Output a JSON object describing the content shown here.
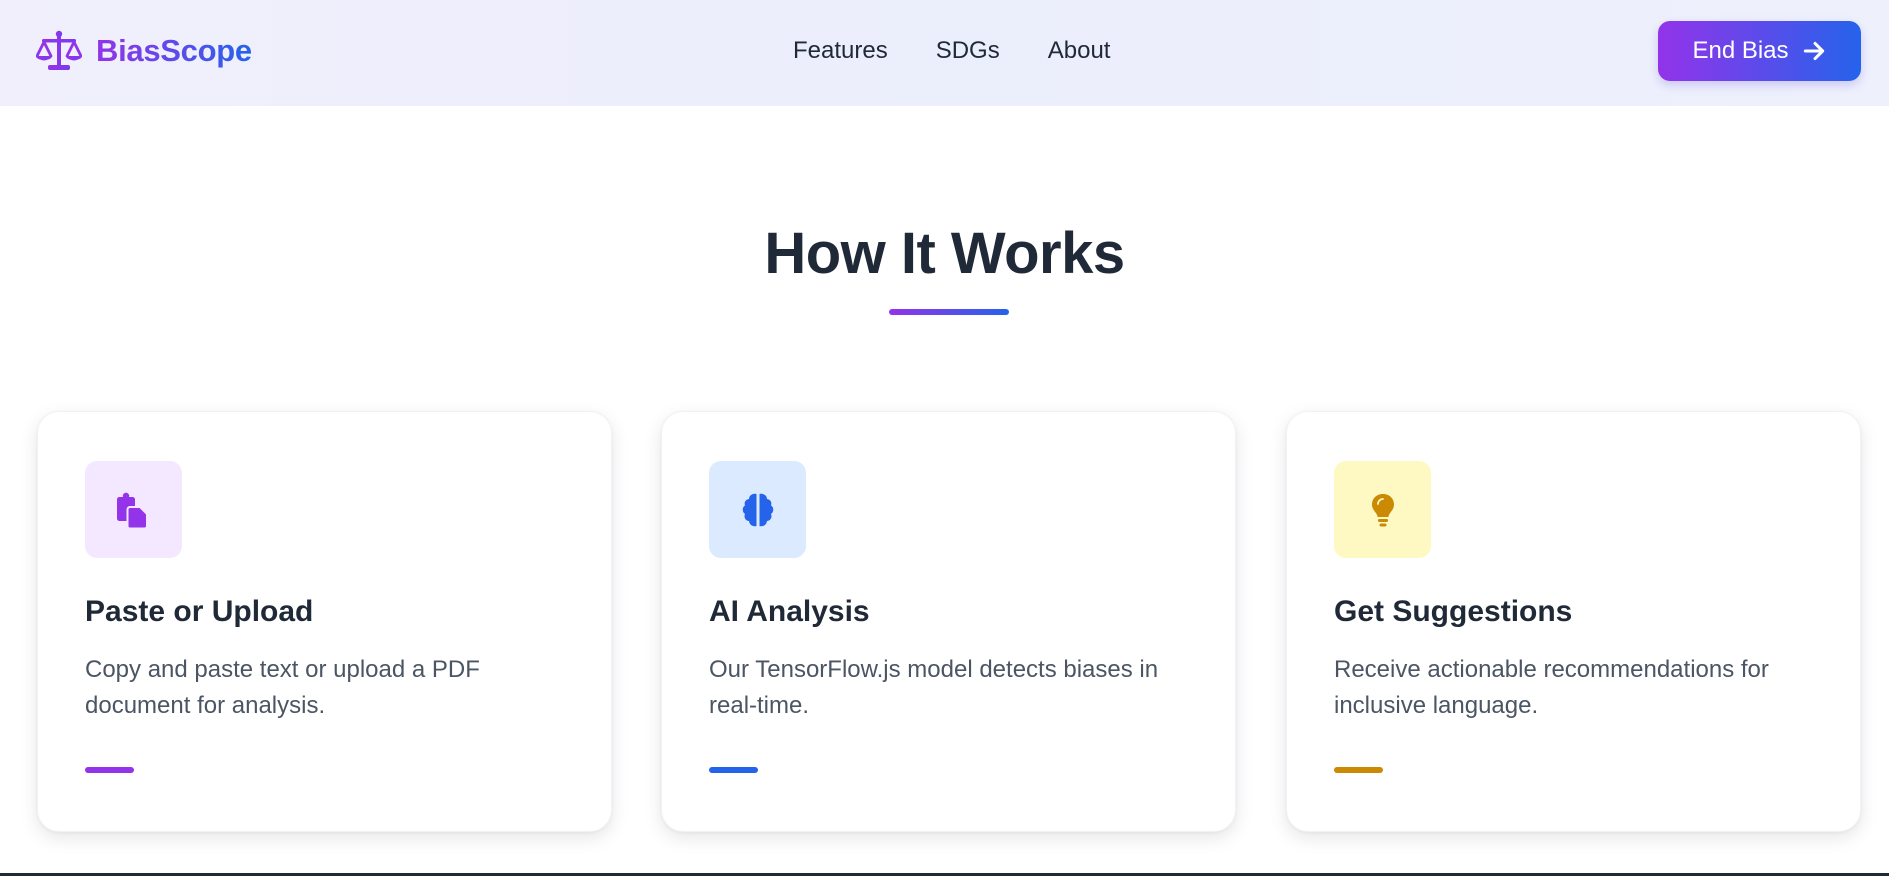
{
  "brand": {
    "name": "BiasScope",
    "icon": "scale-balance-icon"
  },
  "nav": {
    "links": [
      "Features",
      "SDGs",
      "About"
    ]
  },
  "cta": {
    "label": "End Bias",
    "icon": "arrow-right-icon"
  },
  "section": {
    "title": "How It Works"
  },
  "cards": [
    {
      "title": "Paste or Upload",
      "description": "Copy and paste text or upload a PDF document for analysis.",
      "icon": "clipboard-copy-icon",
      "accent_color": "#9333ea",
      "icon_bg": "#f3e8ff"
    },
    {
      "title": "AI Analysis",
      "description": "Our TensorFlow.js model detects biases in real-time.",
      "icon": "brain-icon",
      "accent_color": "#2563eb",
      "icon_bg": "#dbeafe"
    },
    {
      "title": "Get Suggestions",
      "description": "Receive actionable recommendations for inclusive language.",
      "icon": "lightbulb-icon",
      "accent_color": "#ca8a04",
      "icon_bg": "#fef9c3"
    }
  ],
  "colors": {
    "gradient_start": "#9333ea",
    "gradient_end": "#2563eb",
    "heading_text": "#1f2937",
    "body_text": "#4b5563"
  }
}
